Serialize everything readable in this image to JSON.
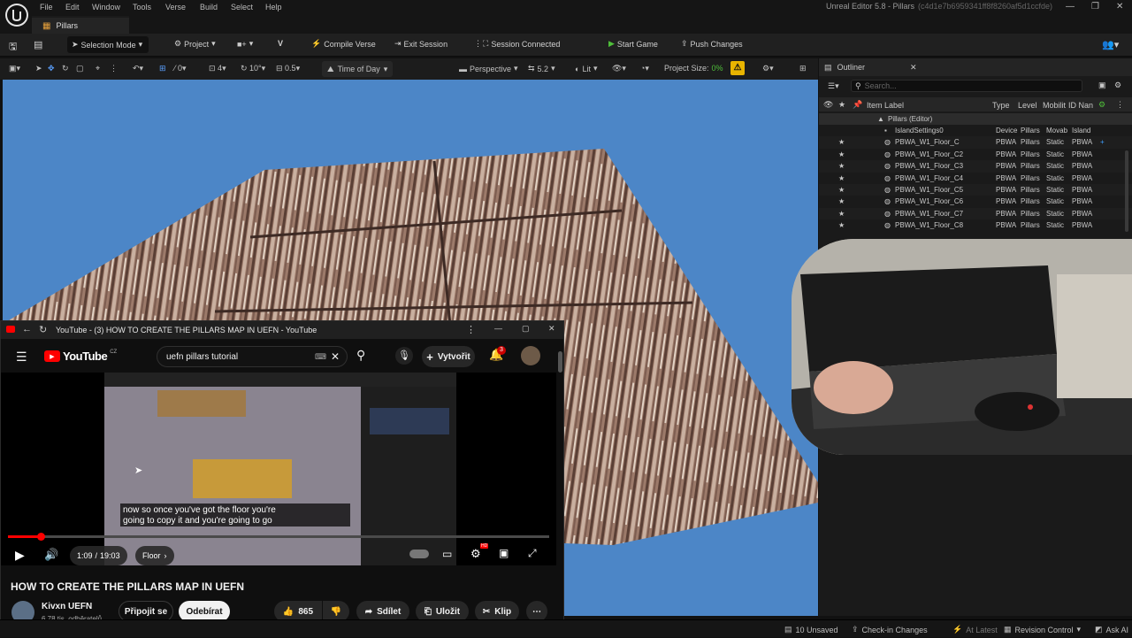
{
  "menu": [
    "File",
    "Edit",
    "Window",
    "Tools",
    "Verse",
    "Build",
    "Select",
    "Help"
  ],
  "window_title": "Unreal Editor 5.8 - Pillars",
  "window_hash": "(c4d1e7b6959341ff8f8260af5d1ccfde)",
  "doc_tab": "Pillars",
  "toolbar": {
    "selection_mode": "Selection Mode",
    "project": "Project",
    "compile_verse": "Compile Verse",
    "exit_session": "Exit Session",
    "session_status": "Session Connected",
    "start_game": "Start Game",
    "push_changes": "Push Changes"
  },
  "viewport_toolbar": {
    "snap_translate": "0",
    "snap_grid": "4",
    "snap_rotate": "10°",
    "snap_scale": "0.5",
    "time_of_day": "Time of Day",
    "perspective": "Perspective",
    "camera_speed": "5.2",
    "lit": "Lit",
    "project_size_label": "Project Size:",
    "project_size_value": "0%"
  },
  "outliner": {
    "title": "Outliner",
    "search_placeholder": "Search...",
    "columns": [
      "Item Label",
      "Type",
      "Level",
      "Mobilit",
      "ID Nan"
    ],
    "root": "Pillars (Editor)",
    "rows": [
      {
        "label": "IslandSettings0",
        "type": "Device",
        "level": "Pillars",
        "mobility": "Movab",
        "id": "Island"
      },
      {
        "label": "PBWA_W1_Floor_C",
        "type": "PBWA",
        "level": "Pillars",
        "mobility": "Static",
        "id": "PBWA"
      },
      {
        "label": "PBWA_W1_Floor_C2",
        "type": "PBWA",
        "level": "Pillars",
        "mobility": "Static",
        "id": "PBWA"
      },
      {
        "label": "PBWA_W1_Floor_C3",
        "type": "PBWA",
        "level": "Pillars",
        "mobility": "Static",
        "id": "PBWA"
      },
      {
        "label": "PBWA_W1_Floor_C4",
        "type": "PBWA",
        "level": "Pillars",
        "mobility": "Static",
        "id": "PBWA"
      },
      {
        "label": "PBWA_W1_Floor_C5",
        "type": "PBWA",
        "level": "Pillars",
        "mobility": "Static",
        "id": "PBWA"
      },
      {
        "label": "PBWA_W1_Floor_C6",
        "type": "PBWA",
        "level": "Pillars",
        "mobility": "Static",
        "id": "PBWA"
      },
      {
        "label": "PBWA_W1_Floor_C7",
        "type": "PBWA",
        "level": "Pillars",
        "mobility": "Static",
        "id": "PBWA"
      },
      {
        "label": "PBWA_W1_Floor_C8",
        "type": "PBWA",
        "level": "Pillars",
        "mobility": "Static",
        "id": "PBWA"
      }
    ]
  },
  "youtube": {
    "window_title": "YouTube - (3) HOW TO CREATE THE PILLARS MAP IN UEFN - YouTube",
    "logo": "YouTube",
    "logo_region": "CZ",
    "search_query": "uefn pillars tutorial",
    "create_label": "Vytvořit",
    "notif_count": "3",
    "caption_line1": "now so once you've got the floor you're",
    "caption_line2": "going to copy it and you're going to go",
    "time_current": "1:09",
    "time_sep": "/",
    "time_total": "19:03",
    "chapter": "Floor",
    "settings_badge": "HD",
    "progress": 0.06,
    "video_title": "HOW TO CREATE THE PILLARS MAP IN UEFN",
    "channel_name": "Kivxn UEFN",
    "subscribers": "6,78 tis. odběratelů",
    "join_label": "Připojit se",
    "subscribe_label": "Odebírat",
    "likes": "865",
    "share_label": "Sdílet",
    "save_label": "Uložit",
    "clip_label": "Klip"
  },
  "statusbar": {
    "unsaved": "10 Unsaved",
    "checkin": "Check-in Changes",
    "at_latest": "At Latest",
    "revision": "Revision Control",
    "ask_ai": "Ask AI"
  },
  "colors": {
    "sky": "#4c86c7",
    "accent_green": "#4fbf3a",
    "yt_red": "#ff0000",
    "outliner_plus": "#3fa0ff"
  }
}
